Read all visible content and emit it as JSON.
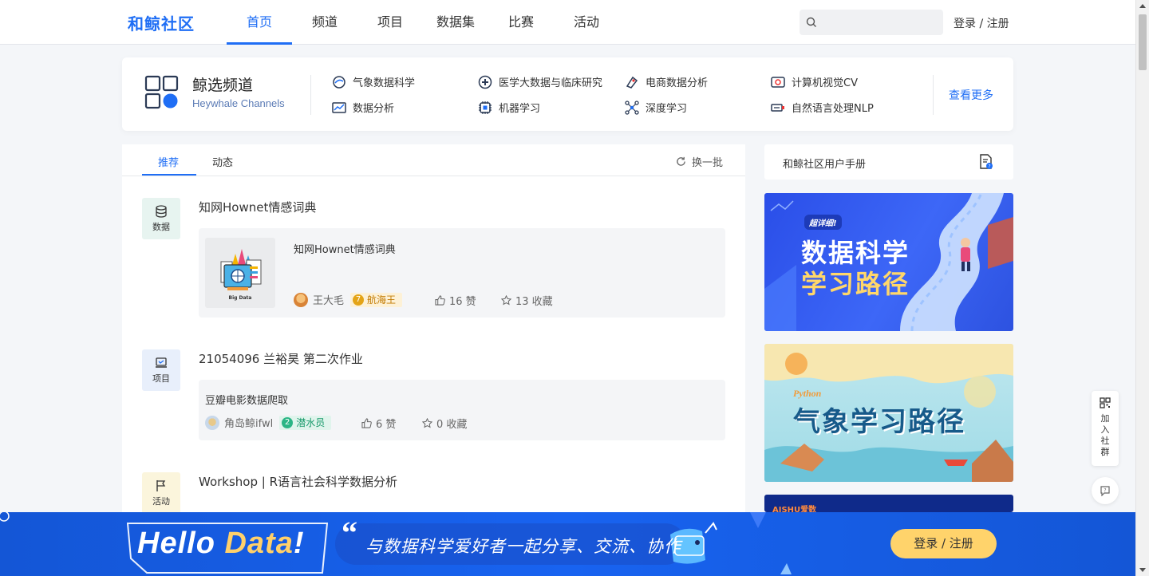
{
  "header": {
    "logo": "和鲸社区",
    "nav": [
      "首页",
      "频道",
      "项目",
      "数据集",
      "比赛",
      "活动"
    ],
    "active_nav": "首页",
    "search_placeholder": "",
    "login": "登录 / 注册"
  },
  "channels": {
    "title": "鲸选频道",
    "subtitle": "Heywhale Channels",
    "items": [
      {
        "label": "气象数据科学",
        "icon": "weather-icon"
      },
      {
        "label": "医学大数据与临床研究",
        "icon": "medical-icon"
      },
      {
        "label": "电商数据分析",
        "icon": "ecommerce-icon"
      },
      {
        "label": "计算机视觉CV",
        "icon": "eye-icon"
      },
      {
        "label": "数据分析",
        "icon": "chart-icon"
      },
      {
        "label": "机器学习",
        "icon": "brain-icon"
      },
      {
        "label": "深度学习",
        "icon": "network-icon"
      },
      {
        "label": "自然语言处理NLP",
        "icon": "nlp-icon"
      }
    ],
    "more": "查看更多"
  },
  "feed": {
    "tabs": [
      "推荐",
      "动态"
    ],
    "active_tab": "推荐",
    "refresh": "换一批",
    "posts": [
      {
        "type": "数据",
        "title": "知网Hownet情感词典",
        "card_title": "知网Hownet情感词典",
        "thumb_label": "Big Data",
        "author": "王大毛",
        "level_num": "7",
        "level_name": "航海王",
        "likes": "16 赞",
        "favorites": "13 收藏"
      },
      {
        "type": "项目",
        "title": "21054096 兰裕昊 第二次作业",
        "card_title": "豆瓣电影数据爬取",
        "author": "角岛鲸ifwl",
        "level_num": "2",
        "level_name": "潜水员",
        "likes": "6 赞",
        "favorites": "0 收藏"
      },
      {
        "type": "活动",
        "title": "Workshop | R语言社会科学数据分析"
      }
    ]
  },
  "sidebar": {
    "manual": "和鲸社区用户手册",
    "banner1": {
      "tag": "超详细!",
      "line1": "数据科学",
      "line2": "学习路径"
    },
    "banner2": {
      "tag": "Python",
      "text": "气象学习路径"
    },
    "banner3": {
      "text": "AISHU爱数"
    }
  },
  "floating": {
    "join": "加入社群"
  },
  "bottom_bar": {
    "hello_white": "Hello ",
    "hello_yellow": "Data",
    "hello_end": "!",
    "quote": "“",
    "slogan": "与数据科学爱好者一起分享、交流、协作",
    "login": "登录 / 注册"
  },
  "colors": {
    "accent": "#1f6ef5",
    "bottom_bar": "#1863f0",
    "login_button": "#ffd36b"
  }
}
